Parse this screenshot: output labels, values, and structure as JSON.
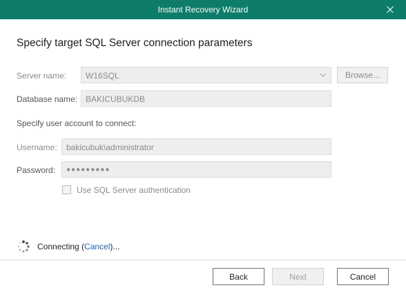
{
  "window": {
    "title": "Instant Recovery Wizard"
  },
  "page": {
    "heading": "Specify target SQL Server connection parameters"
  },
  "form": {
    "server_label": "Server name:",
    "server_value": "W16SQL",
    "browse_label": "Browse...",
    "database_label": "Database name:",
    "database_value": "BAKICUBUKDB",
    "account_prompt": "Specify user account to connect:",
    "username_label": "Username:",
    "username_value": "bakicubuk\\administrator",
    "password_label": "Password:",
    "password_value": "●●●●●●●●●",
    "sql_auth_label": "Use SQL Server authentication"
  },
  "status": {
    "prefix": "Connecting (",
    "cancel_link": "Cancel",
    "suffix": ")..."
  },
  "buttons": {
    "back": "Back",
    "next": "Next",
    "cancel": "Cancel"
  },
  "icons": {
    "close": "close-icon",
    "dropdown": "chevron-down-icon",
    "spinner": "spinner-icon"
  },
  "colors": {
    "titlebar": "#0d7d6a",
    "link": "#1a5fb4"
  }
}
